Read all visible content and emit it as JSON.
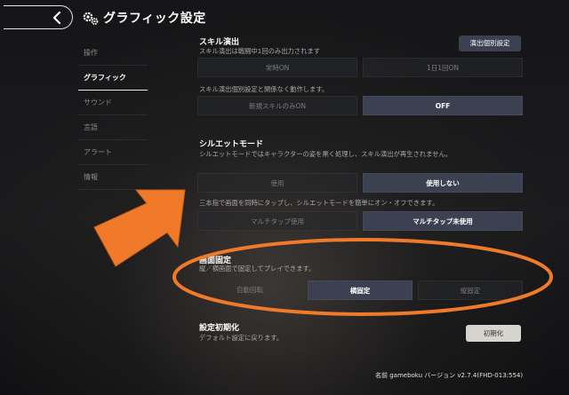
{
  "header": {
    "title": "グラフィック設定"
  },
  "sidebar": {
    "items": [
      {
        "label": "操作"
      },
      {
        "label": "グラフィック"
      },
      {
        "label": "サウンド"
      },
      {
        "label": "言語"
      },
      {
        "label": "アラート"
      },
      {
        "label": "情報"
      }
    ]
  },
  "skill": {
    "title": "スキル演出",
    "desc": "スキル演出は戦闘中1回のみ出力されます",
    "detail_button": "演出個別設定",
    "options": [
      "常時ON",
      "1日1回ON"
    ],
    "desc2": "スキル演出個別設定と関係なく動作します。",
    "options2": [
      "新規スキルのみON",
      "OFF"
    ]
  },
  "silhouette": {
    "title": "シルエットモード",
    "desc": "シルエットモードではキャラクターの姿を黒く処理し、スキル演出が再生されません。",
    "options": [
      "使用",
      "使用しない"
    ],
    "desc2": "三本指で画面を同時にタップし、シルエットモードを簡単にオン・オフできます。",
    "options2": [
      "マルチタップ使用",
      "マルチタップ未使用"
    ]
  },
  "screen_lock": {
    "title": "画面固定",
    "desc": "縦／横画面で固定してプレイできます。",
    "options": [
      "自動回転",
      "横固定",
      "縦固定"
    ]
  },
  "reset": {
    "title": "設定初期化",
    "desc": "デフォルト設定に戻ります。",
    "button": "初期化"
  },
  "version_text": "名前 gameboku バージョン v2.7.4(FHD-013:554)",
  "colors": {
    "annotation_orange": "#f07a2a",
    "selected_option": "#3b4150",
    "background": "#18181a"
  }
}
